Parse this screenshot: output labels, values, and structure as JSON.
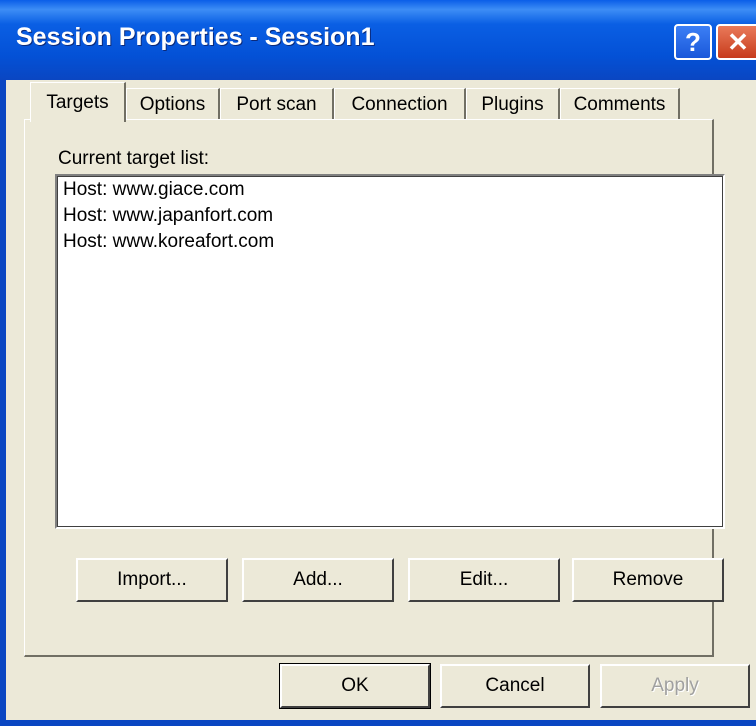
{
  "window": {
    "title": "Session Properties - Session1",
    "help_glyph": "?",
    "close_glyph": "✕"
  },
  "tabs": [
    {
      "label": "Targets",
      "active": true
    },
    {
      "label": "Options"
    },
    {
      "label": "Port scan"
    },
    {
      "label": "Connection"
    },
    {
      "label": "Plugins"
    },
    {
      "label": "Comments"
    }
  ],
  "targets": {
    "list_label": "Current target list:",
    "items": [
      "Host: www.giace.com",
      "Host: www.japanfort.com",
      "Host: www.koreafort.com"
    ],
    "buttons": {
      "import": "Import...",
      "add": "Add...",
      "edit": "Edit...",
      "remove": "Remove"
    }
  },
  "footer": {
    "ok": "OK",
    "cancel": "Cancel",
    "apply": "Apply"
  }
}
